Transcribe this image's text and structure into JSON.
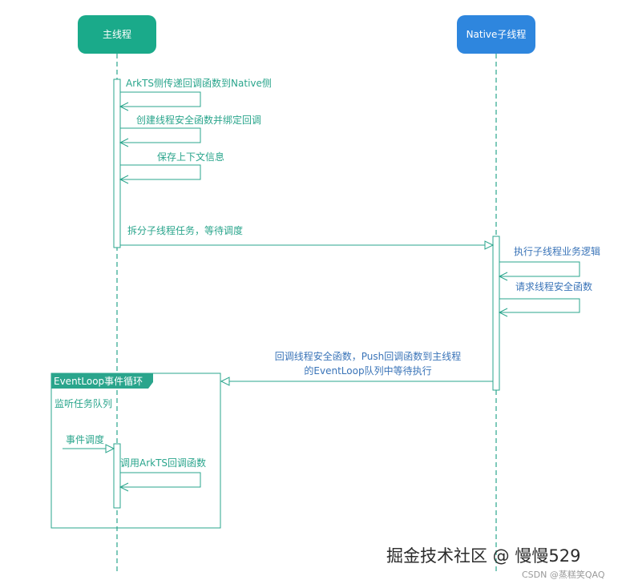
{
  "actors": {
    "main": {
      "label": "主线程",
      "color": "#1aaa8a"
    },
    "native": {
      "label": "Native子线程",
      "color": "#2e86de"
    }
  },
  "messages": {
    "m1": "ArkTS侧传递回调函数到Native侧",
    "m2": "创建线程安全函数并绑定回调",
    "m3": "保存上下文信息",
    "m4": "拆分子线程任务，等待调度",
    "m5": "执行子线程业务逻辑",
    "m6": "请求线程安全函数",
    "m7_line1": "回调线程安全函数，Push回调函数到主线程",
    "m7_line2": "的EventLoop队列中等待执行",
    "m8": "事件调度",
    "m9": "调用ArkTS回调函数"
  },
  "frame": {
    "tag": "EventLoop事件循环",
    "note": "监听任务队列"
  },
  "watermark": {
    "main": "掘金技术社区 @ 慢慢529",
    "sub": "CSDN @蒸糕笑QAQ"
  },
  "colors": {
    "green": "#2aa58c",
    "blue": "#3a74b8"
  }
}
